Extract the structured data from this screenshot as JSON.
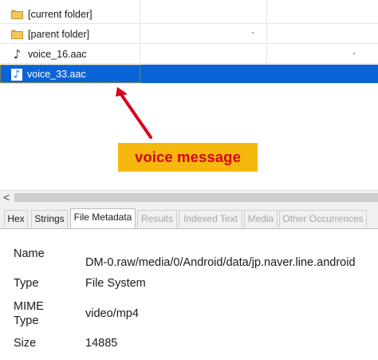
{
  "file_list": {
    "rows": [
      {
        "name": "[current folder]",
        "icon": "folder-icon"
      },
      {
        "name": "[parent folder]",
        "icon": "folder-icon"
      },
      {
        "name": "voice_16.aac",
        "icon": "music-note-icon"
      },
      {
        "name": "voice_33.aac",
        "icon": "music-note-icon",
        "selected": true
      }
    ]
  },
  "annotation": {
    "label": "voice message",
    "arrow_color": "#d8001c",
    "box_color": "#f6b80d"
  },
  "scrollbar": {
    "left_arrow": "<"
  },
  "tabs": [
    {
      "label": "Hex",
      "state": "normal"
    },
    {
      "label": "Strings",
      "state": "normal"
    },
    {
      "label": "File Metadata",
      "state": "active"
    },
    {
      "label": "Results",
      "state": "disabled"
    },
    {
      "label": "Indexed Text",
      "state": "disabled"
    },
    {
      "label": "Media",
      "state": "disabled"
    },
    {
      "label": "Other Occurrences",
      "state": "disabled"
    }
  ],
  "metadata": {
    "name_key": "Name",
    "name_value": "DM-0.raw/media/0/Android/data/jp.naver.line.android",
    "type_key": "Type",
    "type_value": "File System",
    "mime_key_line1": "MIME",
    "mime_key_line2": "Type",
    "mime_value": "video/mp4",
    "size_key": "Size",
    "size_value": "14885"
  },
  "colors": {
    "selection": "#0a64d6",
    "folder": "#f2c75c"
  }
}
